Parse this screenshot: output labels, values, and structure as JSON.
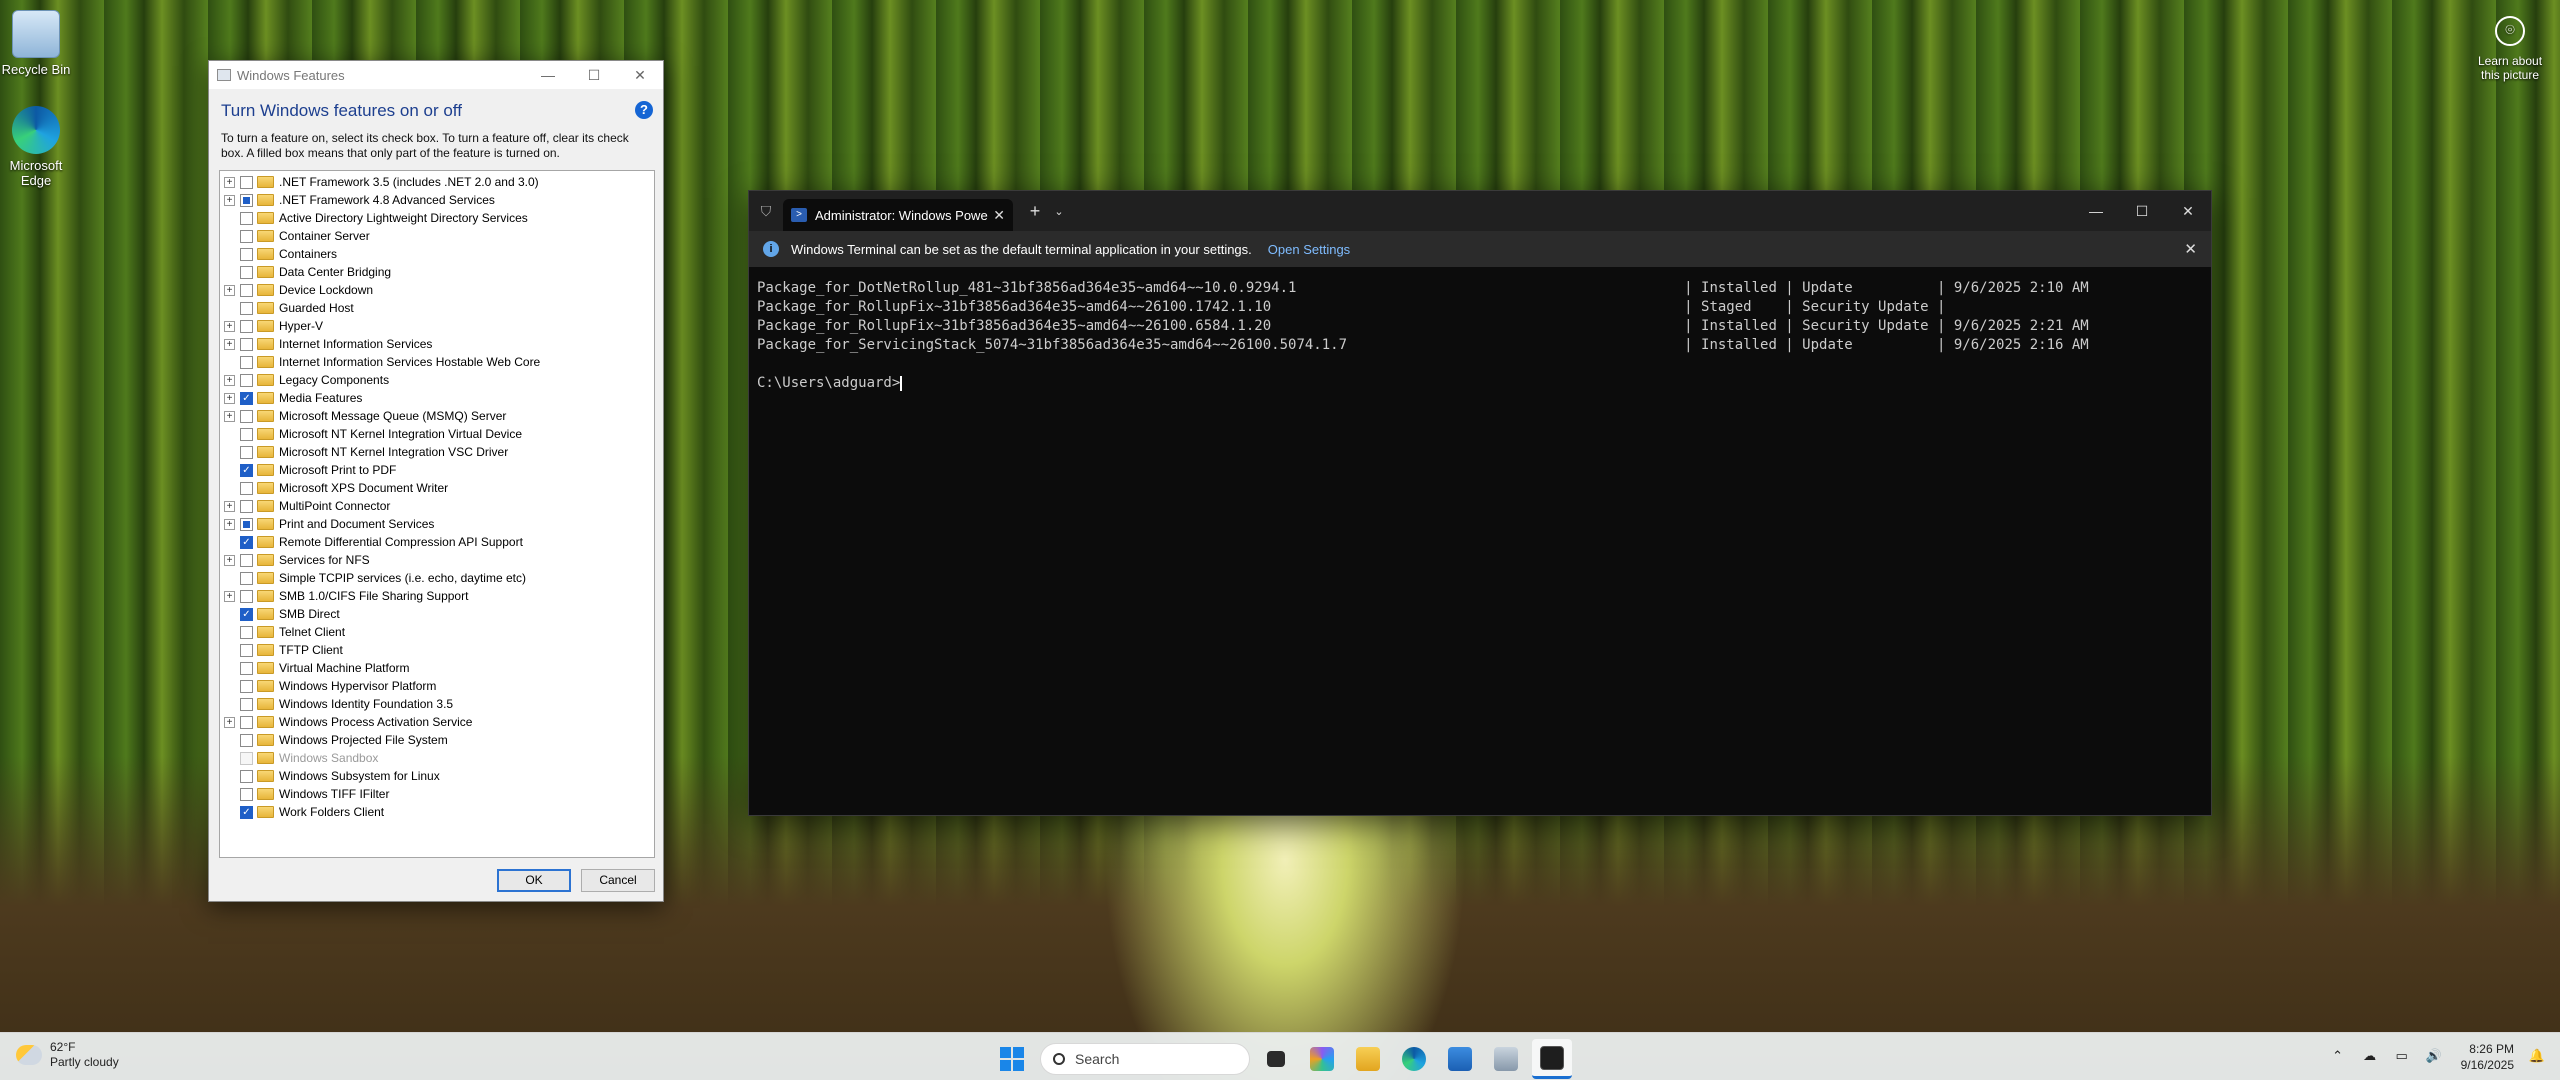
{
  "desktop": {
    "recycle_bin": "Recycle Bin",
    "edge": "Microsoft Edge",
    "learn": "Learn about this picture"
  },
  "features": {
    "window_title": "Windows Features",
    "heading": "Turn Windows features on or off",
    "description": "To turn a feature on, select its check box. To turn a feature off, clear its check box. A filled box means that only part of the feature is turned on.",
    "ok": "OK",
    "cancel": "Cancel",
    "items": [
      {
        "label": ".NET Framework 3.5 (includes .NET 2.0 and 3.0)",
        "expand": true,
        "state": "unchecked"
      },
      {
        "label": ".NET Framework 4.8 Advanced Services",
        "expand": true,
        "state": "partial"
      },
      {
        "label": "Active Directory Lightweight Directory Services",
        "expand": false,
        "state": "unchecked"
      },
      {
        "label": "Container Server",
        "expand": false,
        "state": "unchecked"
      },
      {
        "label": "Containers",
        "expand": false,
        "state": "unchecked"
      },
      {
        "label": "Data Center Bridging",
        "expand": false,
        "state": "unchecked"
      },
      {
        "label": "Device Lockdown",
        "expand": true,
        "state": "unchecked"
      },
      {
        "label": "Guarded Host",
        "expand": false,
        "state": "unchecked"
      },
      {
        "label": "Hyper-V",
        "expand": true,
        "state": "unchecked"
      },
      {
        "label": "Internet Information Services",
        "expand": true,
        "state": "unchecked"
      },
      {
        "label": "Internet Information Services Hostable Web Core",
        "expand": false,
        "state": "unchecked"
      },
      {
        "label": "Legacy Components",
        "expand": true,
        "state": "unchecked"
      },
      {
        "label": "Media Features",
        "expand": true,
        "state": "checked"
      },
      {
        "label": "Microsoft Message Queue (MSMQ) Server",
        "expand": true,
        "state": "unchecked"
      },
      {
        "label": "Microsoft NT Kernel Integration Virtual Device",
        "expand": false,
        "state": "unchecked"
      },
      {
        "label": "Microsoft NT Kernel Integration VSC Driver",
        "expand": false,
        "state": "unchecked"
      },
      {
        "label": "Microsoft Print to PDF",
        "expand": false,
        "state": "checked"
      },
      {
        "label": "Microsoft XPS Document Writer",
        "expand": false,
        "state": "unchecked"
      },
      {
        "label": "MultiPoint Connector",
        "expand": true,
        "state": "unchecked"
      },
      {
        "label": "Print and Document Services",
        "expand": true,
        "state": "partial"
      },
      {
        "label": "Remote Differential Compression API Support",
        "expand": false,
        "state": "checked"
      },
      {
        "label": "Services for NFS",
        "expand": true,
        "state": "unchecked"
      },
      {
        "label": "Simple TCPIP services (i.e. echo, daytime etc)",
        "expand": false,
        "state": "unchecked"
      },
      {
        "label": "SMB 1.0/CIFS File Sharing Support",
        "expand": true,
        "state": "unchecked"
      },
      {
        "label": "SMB Direct",
        "expand": false,
        "state": "checked"
      },
      {
        "label": "Telnet Client",
        "expand": false,
        "state": "unchecked"
      },
      {
        "label": "TFTP Client",
        "expand": false,
        "state": "unchecked"
      },
      {
        "label": "Virtual Machine Platform",
        "expand": false,
        "state": "unchecked"
      },
      {
        "label": "Windows Hypervisor Platform",
        "expand": false,
        "state": "unchecked"
      },
      {
        "label": "Windows Identity Foundation 3.5",
        "expand": false,
        "state": "unchecked"
      },
      {
        "label": "Windows Process Activation Service",
        "expand": true,
        "state": "unchecked"
      },
      {
        "label": "Windows Projected File System",
        "expand": false,
        "state": "unchecked"
      },
      {
        "label": "Windows Sandbox",
        "expand": false,
        "state": "disabled"
      },
      {
        "label": "Windows Subsystem for Linux",
        "expand": false,
        "state": "unchecked"
      },
      {
        "label": "Windows TIFF IFilter",
        "expand": false,
        "state": "unchecked"
      },
      {
        "label": "Work Folders Client",
        "expand": false,
        "state": "checked"
      }
    ]
  },
  "terminal": {
    "tab_title": "Administrator: Windows Powe",
    "info_text": "Windows Terminal can be set as the default terminal application in your settings.",
    "info_link": "Open Settings",
    "lines": [
      "Package_for_DotNetRollup_481~31bf3856ad364e35~amd64~~10.0.9294.1                                              | Installed | Update          | 9/6/2025 2:10 AM",
      "Package_for_RollupFix~31bf3856ad364e35~amd64~~26100.1742.1.10                                                 | Staged    | Security Update |",
      "Package_for_RollupFix~31bf3856ad364e35~amd64~~26100.6584.1.20                                                 | Installed | Security Update | 9/6/2025 2:21 AM",
      "Package_for_ServicingStack_5074~31bf3856ad364e35~amd64~~26100.5074.1.7                                        | Installed | Update          | 9/6/2025 2:16 AM",
      "",
      "C:\\Users\\adguard>"
    ]
  },
  "taskbar": {
    "temp": "62°F",
    "condition": "Partly cloudy",
    "search_placeholder": "Search",
    "time": "8:26 PM",
    "date": "9/16/2025"
  }
}
